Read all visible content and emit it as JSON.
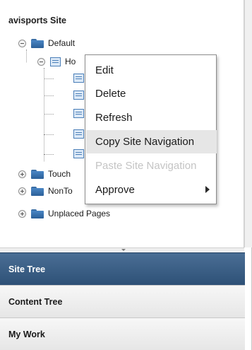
{
  "tree": {
    "site_title": "avisports Site",
    "nodes": [
      {
        "label": "Default",
        "toggle": "minus",
        "icon": "folder-icon"
      },
      {
        "label": "Ho",
        "toggle": "minus",
        "icon": "page-icon"
      },
      {
        "label": "Touch",
        "toggle": "plus",
        "icon": "folder-icon"
      },
      {
        "label": "NonTo",
        "toggle": "plus",
        "icon": "folder-icon"
      },
      {
        "label": "Unplaced Pages",
        "toggle": "plus",
        "icon": "folder-icon"
      }
    ]
  },
  "context_menu": {
    "items": [
      {
        "label": "Edit",
        "state": "enabled"
      },
      {
        "label": "Delete",
        "state": "enabled"
      },
      {
        "label": "Refresh",
        "state": "enabled"
      },
      {
        "label": "Copy Site Navigation",
        "state": "hover"
      },
      {
        "label": "Paste Site Navigation",
        "state": "disabled"
      },
      {
        "label": "Approve",
        "state": "enabled",
        "submenu": true
      }
    ]
  },
  "accordion": {
    "tabs": [
      {
        "label": "Site Tree",
        "active": true
      },
      {
        "label": "Content Tree",
        "active": false
      },
      {
        "label": "My Work",
        "active": false
      }
    ]
  },
  "colors": {
    "active_tab": "#3d6089",
    "folder_blue": "#3a6ea5",
    "menu_hover": "#e6e6e6",
    "disabled_text": "#c4c4c4"
  }
}
